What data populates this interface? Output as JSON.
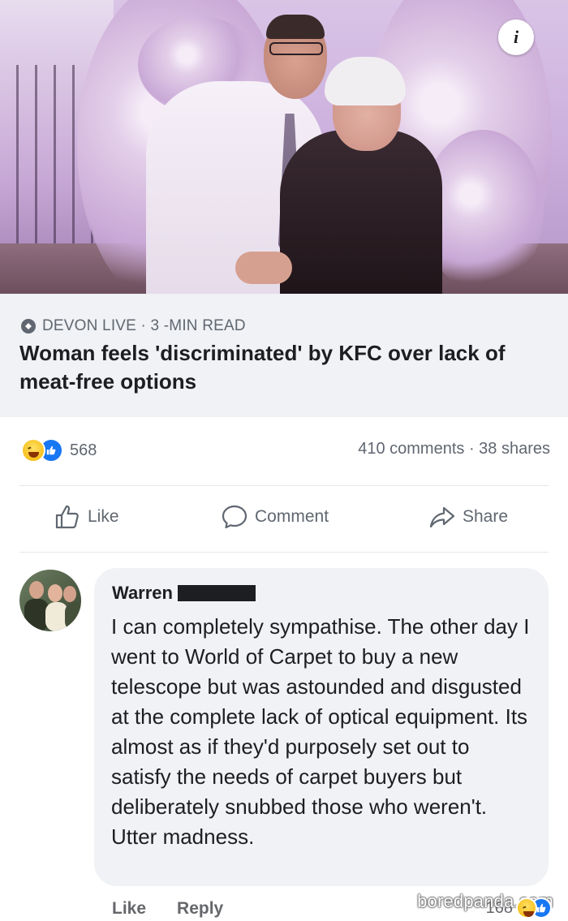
{
  "post": {
    "info_label": "i",
    "link": {
      "source": "DEVON LIVE · 3 -MIN READ",
      "headline": "Woman feels 'discriminated' by KFC over lack of meat-free options"
    },
    "reactions": {
      "count": "568",
      "summary": "410 comments · 38 shares"
    },
    "actions": {
      "like": "Like",
      "comment": "Comment",
      "share": "Share"
    }
  },
  "comment": {
    "author": "Warren",
    "text": "I can completely sympathise. The other day I went to World of Carpet to buy a new telescope but was astounded and disgusted at the complete lack of optical equipment. Its almost as if they'd purposely set out to satisfy the needs of carpet buyers but deliberately snubbed those who weren't. Utter madness.",
    "like_label": "Like",
    "reply_label": "Reply",
    "reaction_count": "168"
  },
  "watermark": "boredpanda.com",
  "colors": {
    "link_box_bg": "#f0f2f5",
    "meta_text": "#606770",
    "like_blue": "#1877f2",
    "text": "#1c1e21"
  },
  "icons": [
    "info-icon",
    "globe-icon",
    "haha-reaction-icon",
    "like-reaction-icon",
    "thumbs-up-icon",
    "comment-icon",
    "share-icon"
  ]
}
